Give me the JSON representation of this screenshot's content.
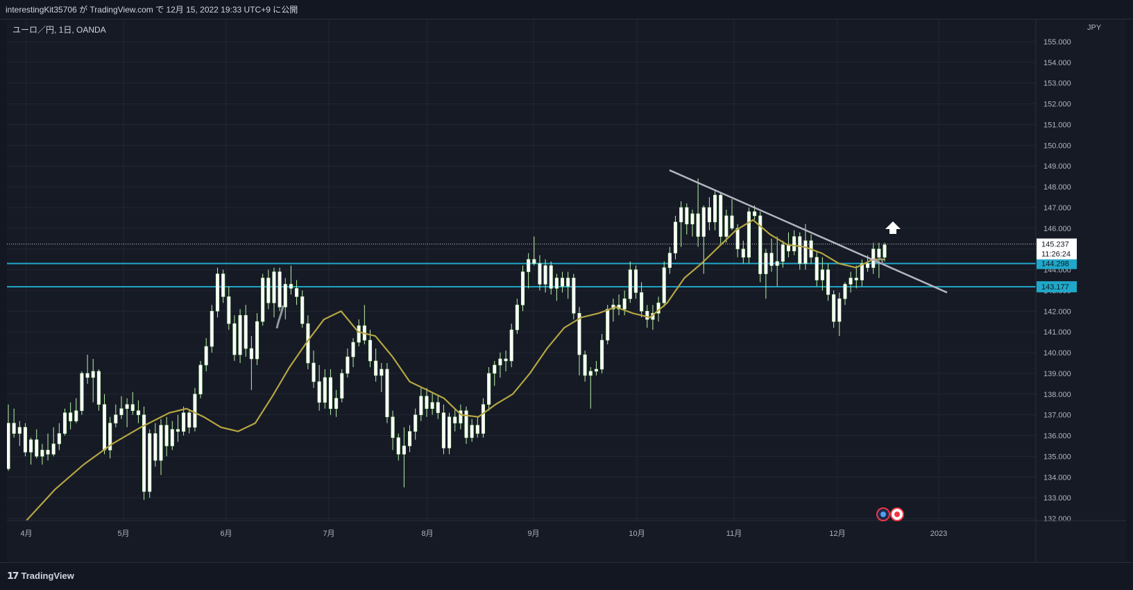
{
  "header": {
    "publish_line": "interestingKit35706 が TradingView.com で 12月 15, 2022 19:33 UTC+9 に公開"
  },
  "chart": {
    "symbol_line": "ユーロ／円, 1日, OANDA",
    "currency_unit": "JPY",
    "current_price": "145.237",
    "countdown": "11:26:24",
    "level_upper_label": "144.298",
    "level_lower_label": "143.177"
  },
  "footer": {
    "brand": "TradingView"
  },
  "colors": {
    "background": "#161a25",
    "grid": "#232734",
    "candle_up": "#ffffff",
    "candle_down": "#ffffff",
    "wick": "#b9f6a8",
    "ma_line": "#b5a642",
    "level_line": "#1fa8c9",
    "trend_line": "#b3b6c0",
    "price_label_bg": "#ffffff"
  },
  "chart_data": {
    "type": "candlestick",
    "title": "ユーロ／円, 1日, OANDA",
    "y_axis_label": "JPY",
    "ylim": [
      131.7,
      156.2
    ],
    "y_ticks": [
      132.0,
      133.0,
      134.0,
      135.0,
      136.0,
      137.0,
      138.0,
      139.0,
      140.0,
      141.0,
      142.0,
      143.0,
      144.0,
      145.0,
      146.0,
      147.0,
      148.0,
      149.0,
      150.0,
      151.0,
      152.0,
      153.0,
      154.0,
      155.0
    ],
    "x_ticks": [
      "4月",
      "5月",
      "6月",
      "7月",
      "8月",
      "9月",
      "10月",
      "11月",
      "12月",
      "2023"
    ],
    "grid": true,
    "horizontal_levels": [
      144.298,
      143.177
    ],
    "last_price": 145.237,
    "trendline": {
      "from": {
        "date": "2022-10-10",
        "price": 148.8
      },
      "to": {
        "date": "2023-01-14",
        "price": 142.9
      }
    },
    "ma_series": [
      {
        "x": 0,
        "y": 131.9
      },
      {
        "x": 10,
        "y": 133.4
      },
      {
        "x": 20,
        "y": 134.6
      },
      {
        "x": 30,
        "y": 135.6
      },
      {
        "x": 40,
        "y": 136.4
      },
      {
        "x": 50,
        "y": 137.1
      },
      {
        "x": 56,
        "y": 137.3
      },
      {
        "x": 62,
        "y": 136.9
      },
      {
        "x": 68,
        "y": 136.4
      },
      {
        "x": 74,
        "y": 136.2
      },
      {
        "x": 80,
        "y": 136.6
      },
      {
        "x": 86,
        "y": 137.9
      },
      {
        "x": 92,
        "y": 139.3
      },
      {
        "x": 98,
        "y": 140.5
      },
      {
        "x": 104,
        "y": 141.6
      },
      {
        "x": 110,
        "y": 142.0
      },
      {
        "x": 116,
        "y": 141.0
      },
      {
        "x": 122,
        "y": 140.8
      },
      {
        "x": 128,
        "y": 139.8
      },
      {
        "x": 134,
        "y": 138.6
      },
      {
        "x": 140,
        "y": 138.2
      },
      {
        "x": 146,
        "y": 137.8
      },
      {
        "x": 152,
        "y": 137.0
      },
      {
        "x": 158,
        "y": 136.9
      },
      {
        "x": 164,
        "y": 137.5
      },
      {
        "x": 170,
        "y": 138.0
      },
      {
        "x": 176,
        "y": 139.0
      },
      {
        "x": 182,
        "y": 140.2
      },
      {
        "x": 188,
        "y": 141.2
      },
      {
        "x": 194,
        "y": 141.7
      },
      {
        "x": 200,
        "y": 141.9
      },
      {
        "x": 206,
        "y": 142.2
      },
      {
        "x": 212,
        "y": 141.9
      },
      {
        "x": 218,
        "y": 141.7
      },
      {
        "x": 224,
        "y": 142.4
      },
      {
        "x": 230,
        "y": 143.6
      },
      {
        "x": 236,
        "y": 144.3
      },
      {
        "x": 242,
        "y": 145.1
      },
      {
        "x": 248,
        "y": 145.9
      },
      {
        "x": 254,
        "y": 146.4
      },
      {
        "x": 260,
        "y": 145.7
      },
      {
        "x": 266,
        "y": 145.2
      },
      {
        "x": 272,
        "y": 145.1
      },
      {
        "x": 278,
        "y": 144.8
      },
      {
        "x": 284,
        "y": 144.3
      },
      {
        "x": 290,
        "y": 144.1
      },
      {
        "x": 296,
        "y": 144.5
      },
      {
        "x": 300,
        "y": 144.5
      }
    ],
    "candles": [
      {
        "o": 134.4,
        "h": 137.5,
        "l": 134.3,
        "c": 136.6
      },
      {
        "o": 136.6,
        "h": 137.3,
        "l": 135.9,
        "c": 136.1
      },
      {
        "o": 136.1,
        "h": 136.7,
        "l": 135.5,
        "c": 136.4
      },
      {
        "o": 136.4,
        "h": 136.6,
        "l": 135.0,
        "c": 135.2
      },
      {
        "o": 135.2,
        "h": 135.9,
        "l": 134.6,
        "c": 135.8
      },
      {
        "o": 135.8,
        "h": 136.3,
        "l": 134.9,
        "c": 135.0
      },
      {
        "o": 135.0,
        "h": 135.6,
        "l": 134.6,
        "c": 135.3
      },
      {
        "o": 135.3,
        "h": 136.1,
        "l": 134.8,
        "c": 135.1
      },
      {
        "o": 135.1,
        "h": 136.4,
        "l": 135.0,
        "c": 135.6
      },
      {
        "o": 135.6,
        "h": 136.6,
        "l": 135.3,
        "c": 136.1
      },
      {
        "o": 136.1,
        "h": 137.3,
        "l": 136.0,
        "c": 137.1
      },
      {
        "o": 137.1,
        "h": 137.6,
        "l": 136.3,
        "c": 136.7
      },
      {
        "o": 136.7,
        "h": 137.8,
        "l": 136.6,
        "c": 137.2
      },
      {
        "o": 137.2,
        "h": 139.1,
        "l": 137.0,
        "c": 139.0
      },
      {
        "o": 139.0,
        "h": 139.9,
        "l": 138.5,
        "c": 138.8
      },
      {
        "o": 138.8,
        "h": 139.7,
        "l": 137.6,
        "c": 139.1
      },
      {
        "o": 139.1,
        "h": 139.2,
        "l": 137.2,
        "c": 137.5
      },
      {
        "o": 137.5,
        "h": 138.0,
        "l": 135.1,
        "c": 135.3
      },
      {
        "o": 135.3,
        "h": 136.9,
        "l": 134.9,
        "c": 136.6
      },
      {
        "o": 136.6,
        "h": 137.5,
        "l": 136.4,
        "c": 137.0
      },
      {
        "o": 137.0,
        "h": 137.9,
        "l": 136.8,
        "c": 137.3
      },
      {
        "o": 137.3,
        "h": 137.8,
        "l": 136.4,
        "c": 137.5
      },
      {
        "o": 137.5,
        "h": 138.1,
        "l": 137.0,
        "c": 137.2
      },
      {
        "o": 137.2,
        "h": 137.7,
        "l": 136.6,
        "c": 137.0
      },
      {
        "o": 137.0,
        "h": 137.4,
        "l": 132.9,
        "c": 133.3
      },
      {
        "o": 133.3,
        "h": 136.3,
        "l": 133.0,
        "c": 136.1
      },
      {
        "o": 136.1,
        "h": 136.6,
        "l": 134.5,
        "c": 134.8
      },
      {
        "o": 134.8,
        "h": 136.8,
        "l": 134.1,
        "c": 136.5
      },
      {
        "o": 136.5,
        "h": 136.9,
        "l": 135.0,
        "c": 135.5
      },
      {
        "o": 135.5,
        "h": 136.7,
        "l": 135.3,
        "c": 136.3
      },
      {
        "o": 136.3,
        "h": 137.0,
        "l": 135.7,
        "c": 136.2
      },
      {
        "o": 136.2,
        "h": 137.4,
        "l": 136.0,
        "c": 137.1
      },
      {
        "o": 137.1,
        "h": 137.2,
        "l": 136.1,
        "c": 136.4
      },
      {
        "o": 136.4,
        "h": 138.3,
        "l": 136.2,
        "c": 138.0
      },
      {
        "o": 138.0,
        "h": 139.6,
        "l": 137.8,
        "c": 139.4
      },
      {
        "o": 139.4,
        "h": 140.7,
        "l": 139.1,
        "c": 140.3
      },
      {
        "o": 140.3,
        "h": 142.3,
        "l": 140.0,
        "c": 142.0
      },
      {
        "o": 142.0,
        "h": 144.1,
        "l": 141.7,
        "c": 143.8
      },
      {
        "o": 143.8,
        "h": 144.0,
        "l": 142.4,
        "c": 142.7
      },
      {
        "o": 142.7,
        "h": 143.2,
        "l": 141.1,
        "c": 141.4
      },
      {
        "o": 141.4,
        "h": 141.8,
        "l": 139.6,
        "c": 139.9
      },
      {
        "o": 139.9,
        "h": 142.1,
        "l": 139.5,
        "c": 141.8
      },
      {
        "o": 141.8,
        "h": 142.3,
        "l": 139.8,
        "c": 140.2
      },
      {
        "o": 140.2,
        "h": 140.8,
        "l": 138.2,
        "c": 139.7
      },
      {
        "o": 139.7,
        "h": 141.9,
        "l": 139.4,
        "c": 141.5
      },
      {
        "o": 141.5,
        "h": 143.8,
        "l": 141.3,
        "c": 143.6
      },
      {
        "o": 143.6,
        "h": 144.0,
        "l": 142.1,
        "c": 142.4
      },
      {
        "o": 142.4,
        "h": 144.1,
        "l": 141.7,
        "c": 143.9
      },
      {
        "o": 143.9,
        "h": 144.1,
        "l": 142.0,
        "c": 142.2
      },
      {
        "o": 142.2,
        "h": 143.6,
        "l": 141.6,
        "c": 143.3
      },
      {
        "o": 143.3,
        "h": 144.2,
        "l": 142.8,
        "c": 143.1
      },
      {
        "o": 143.1,
        "h": 143.5,
        "l": 142.3,
        "c": 142.7
      },
      {
        "o": 142.7,
        "h": 143.0,
        "l": 141.2,
        "c": 141.4
      },
      {
        "o": 141.4,
        "h": 141.8,
        "l": 139.2,
        "c": 139.5
      },
      {
        "o": 139.5,
        "h": 140.1,
        "l": 138.3,
        "c": 138.6
      },
      {
        "o": 138.6,
        "h": 139.4,
        "l": 137.2,
        "c": 137.6
      },
      {
        "o": 137.6,
        "h": 139.2,
        "l": 137.3,
        "c": 138.8
      },
      {
        "o": 138.8,
        "h": 139.2,
        "l": 137.0,
        "c": 137.3
      },
      {
        "o": 137.3,
        "h": 138.2,
        "l": 136.9,
        "c": 137.8
      },
      {
        "o": 137.8,
        "h": 139.2,
        "l": 137.6,
        "c": 139.0
      },
      {
        "o": 139.0,
        "h": 140.2,
        "l": 138.8,
        "c": 139.8
      },
      {
        "o": 139.8,
        "h": 140.7,
        "l": 139.3,
        "c": 140.5
      },
      {
        "o": 140.5,
        "h": 141.6,
        "l": 140.3,
        "c": 141.3
      },
      {
        "o": 141.3,
        "h": 142.3,
        "l": 140.4,
        "c": 140.6
      },
      {
        "o": 140.6,
        "h": 141.1,
        "l": 139.3,
        "c": 139.6
      },
      {
        "o": 139.6,
        "h": 140.2,
        "l": 138.6,
        "c": 138.9
      },
      {
        "o": 138.9,
        "h": 139.5,
        "l": 138.1,
        "c": 139.2
      },
      {
        "o": 139.2,
        "h": 139.5,
        "l": 136.6,
        "c": 136.9
      },
      {
        "o": 136.9,
        "h": 137.2,
        "l": 135.3,
        "c": 135.9
      },
      {
        "o": 135.9,
        "h": 136.1,
        "l": 134.8,
        "c": 135.1
      },
      {
        "o": 135.1,
        "h": 136.4,
        "l": 133.5,
        "c": 135.5
      },
      {
        "o": 135.5,
        "h": 136.5,
        "l": 135.2,
        "c": 136.2
      },
      {
        "o": 136.2,
        "h": 137.3,
        "l": 135.8,
        "c": 137.0
      },
      {
        "o": 137.0,
        "h": 138.3,
        "l": 136.7,
        "c": 137.9
      },
      {
        "o": 137.9,
        "h": 138.3,
        "l": 136.9,
        "c": 137.3
      },
      {
        "o": 137.3,
        "h": 138.1,
        "l": 137.0,
        "c": 137.6
      },
      {
        "o": 137.6,
        "h": 137.9,
        "l": 136.8,
        "c": 137.1
      },
      {
        "o": 137.1,
        "h": 137.5,
        "l": 135.1,
        "c": 135.4
      },
      {
        "o": 135.4,
        "h": 137.1,
        "l": 135.1,
        "c": 136.9
      },
      {
        "o": 136.9,
        "h": 137.3,
        "l": 136.2,
        "c": 136.6
      },
      {
        "o": 136.6,
        "h": 137.5,
        "l": 136.3,
        "c": 137.2
      },
      {
        "o": 137.2,
        "h": 137.4,
        "l": 135.6,
        "c": 135.9
      },
      {
        "o": 135.9,
        "h": 136.8,
        "l": 135.7,
        "c": 136.5
      },
      {
        "o": 136.5,
        "h": 136.9,
        "l": 135.9,
        "c": 136.1
      },
      {
        "o": 136.1,
        "h": 137.8,
        "l": 135.9,
        "c": 137.5
      },
      {
        "o": 137.5,
        "h": 139.3,
        "l": 137.2,
        "c": 139.0
      },
      {
        "o": 139.0,
        "h": 139.6,
        "l": 138.4,
        "c": 139.4
      },
      {
        "o": 139.4,
        "h": 140.0,
        "l": 138.8,
        "c": 139.7
      },
      {
        "o": 139.7,
        "h": 140.1,
        "l": 139.1,
        "c": 139.6
      },
      {
        "o": 139.6,
        "h": 141.4,
        "l": 139.3,
        "c": 141.1
      },
      {
        "o": 141.1,
        "h": 142.6,
        "l": 140.9,
        "c": 142.3
      },
      {
        "o": 142.3,
        "h": 144.2,
        "l": 142.0,
        "c": 143.9
      },
      {
        "o": 143.9,
        "h": 144.8,
        "l": 143.1,
        "c": 144.5
      },
      {
        "o": 144.5,
        "h": 145.6,
        "l": 144.2,
        "c": 144.3
      },
      {
        "o": 144.3,
        "h": 144.7,
        "l": 143.0,
        "c": 143.3
      },
      {
        "o": 143.3,
        "h": 144.5,
        "l": 142.9,
        "c": 144.2
      },
      {
        "o": 144.2,
        "h": 144.4,
        "l": 142.8,
        "c": 143.1
      },
      {
        "o": 143.1,
        "h": 143.8,
        "l": 142.5,
        "c": 143.6
      },
      {
        "o": 143.6,
        "h": 143.9,
        "l": 142.9,
        "c": 143.2
      },
      {
        "o": 143.2,
        "h": 143.9,
        "l": 142.6,
        "c": 143.6
      },
      {
        "o": 143.6,
        "h": 143.8,
        "l": 141.6,
        "c": 141.9
      },
      {
        "o": 141.9,
        "h": 142.2,
        "l": 138.9,
        "c": 139.9
      },
      {
        "o": 139.9,
        "h": 140.1,
        "l": 138.6,
        "c": 138.9
      },
      {
        "o": 138.9,
        "h": 139.3,
        "l": 137.3,
        "c": 139.1
      },
      {
        "o": 139.1,
        "h": 139.6,
        "l": 138.9,
        "c": 139.2
      },
      {
        "o": 139.2,
        "h": 140.9,
        "l": 139.0,
        "c": 140.6
      },
      {
        "o": 140.6,
        "h": 142.3,
        "l": 140.4,
        "c": 142.1
      },
      {
        "o": 142.1,
        "h": 142.6,
        "l": 141.5,
        "c": 142.3
      },
      {
        "o": 142.3,
        "h": 142.8,
        "l": 141.8,
        "c": 142.1
      },
      {
        "o": 142.1,
        "h": 143.0,
        "l": 141.8,
        "c": 142.6
      },
      {
        "o": 142.6,
        "h": 144.4,
        "l": 142.4,
        "c": 144.0
      },
      {
        "o": 144.0,
        "h": 144.2,
        "l": 142.6,
        "c": 142.9
      },
      {
        "o": 142.9,
        "h": 143.4,
        "l": 141.7,
        "c": 142.0
      },
      {
        "o": 142.0,
        "h": 142.3,
        "l": 141.2,
        "c": 141.6
      },
      {
        "o": 141.6,
        "h": 142.3,
        "l": 141.1,
        "c": 141.9
      },
      {
        "o": 141.9,
        "h": 142.7,
        "l": 141.5,
        "c": 142.4
      },
      {
        "o": 142.4,
        "h": 144.4,
        "l": 142.2,
        "c": 144.1
      },
      {
        "o": 144.1,
        "h": 145.1,
        "l": 143.8,
        "c": 144.8
      },
      {
        "o": 144.8,
        "h": 146.6,
        "l": 144.5,
        "c": 146.3
      },
      {
        "o": 146.3,
        "h": 147.3,
        "l": 145.1,
        "c": 147.0
      },
      {
        "o": 147.0,
        "h": 147.2,
        "l": 145.7,
        "c": 146.2
      },
      {
        "o": 146.2,
        "h": 146.9,
        "l": 145.6,
        "c": 146.7
      },
      {
        "o": 146.7,
        "h": 148.4,
        "l": 145.1,
        "c": 145.6
      },
      {
        "o": 145.6,
        "h": 147.1,
        "l": 143.8,
        "c": 147.0
      },
      {
        "o": 147.0,
        "h": 147.5,
        "l": 145.9,
        "c": 146.3
      },
      {
        "o": 146.3,
        "h": 147.8,
        "l": 145.9,
        "c": 147.6
      },
      {
        "o": 147.6,
        "h": 147.7,
        "l": 145.2,
        "c": 145.6
      },
      {
        "o": 145.6,
        "h": 146.9,
        "l": 145.3,
        "c": 146.6
      },
      {
        "o": 146.6,
        "h": 147.4,
        "l": 145.9,
        "c": 146.0
      },
      {
        "o": 146.0,
        "h": 146.2,
        "l": 144.6,
        "c": 145.0
      },
      {
        "o": 145.0,
        "h": 145.4,
        "l": 144.3,
        "c": 144.6
      },
      {
        "o": 144.6,
        "h": 147.0,
        "l": 144.3,
        "c": 146.8
      },
      {
        "o": 146.8,
        "h": 147.1,
        "l": 146.4,
        "c": 146.6
      },
      {
        "o": 146.6,
        "h": 146.8,
        "l": 143.4,
        "c": 143.8
      },
      {
        "o": 143.8,
        "h": 145.0,
        "l": 142.6,
        "c": 144.8
      },
      {
        "o": 144.8,
        "h": 145.5,
        "l": 143.9,
        "c": 144.2
      },
      {
        "o": 144.2,
        "h": 145.6,
        "l": 143.2,
        "c": 144.4
      },
      {
        "o": 144.4,
        "h": 145.4,
        "l": 144.1,
        "c": 145.2
      },
      {
        "o": 145.2,
        "h": 145.8,
        "l": 144.6,
        "c": 144.9
      },
      {
        "o": 144.9,
        "h": 145.9,
        "l": 144.7,
        "c": 145.6
      },
      {
        "o": 145.6,
        "h": 145.8,
        "l": 144.0,
        "c": 144.3
      },
      {
        "o": 144.3,
        "h": 146.2,
        "l": 144.0,
        "c": 145.4
      },
      {
        "o": 145.4,
        "h": 145.7,
        "l": 144.3,
        "c": 144.6
      },
      {
        "o": 144.6,
        "h": 144.9,
        "l": 143.2,
        "c": 143.5
      },
      {
        "o": 143.5,
        "h": 144.6,
        "l": 143.0,
        "c": 144.0
      },
      {
        "o": 144.0,
        "h": 144.3,
        "l": 142.5,
        "c": 142.8
      },
      {
        "o": 142.8,
        "h": 143.0,
        "l": 141.2,
        "c": 141.5
      },
      {
        "o": 141.5,
        "h": 142.9,
        "l": 140.8,
        "c": 142.6
      },
      {
        "o": 142.6,
        "h": 143.4,
        "l": 142.3,
        "c": 143.3
      },
      {
        "o": 143.3,
        "h": 143.9,
        "l": 142.9,
        "c": 143.6
      },
      {
        "o": 143.6,
        "h": 144.2,
        "l": 143.1,
        "c": 143.5
      },
      {
        "o": 143.5,
        "h": 144.5,
        "l": 143.2,
        "c": 144.3
      },
      {
        "o": 144.3,
        "h": 144.7,
        "l": 143.9,
        "c": 144.1
      },
      {
        "o": 144.1,
        "h": 145.3,
        "l": 143.8,
        "c": 145.0
      },
      {
        "o": 145.0,
        "h": 145.3,
        "l": 143.6,
        "c": 144.6
      },
      {
        "o": 144.6,
        "h": 145.3,
        "l": 144.4,
        "c": 145.2
      }
    ]
  }
}
